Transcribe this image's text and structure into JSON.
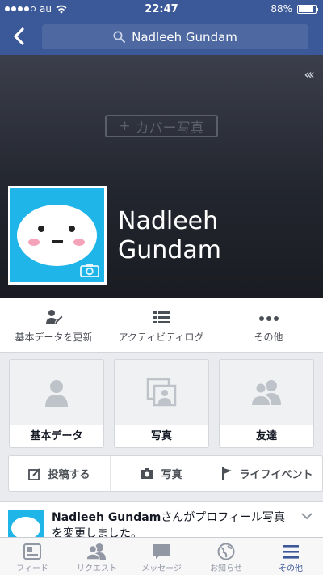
{
  "status_bar": {
    "carrier": "au",
    "time": "22:47",
    "battery": "88%"
  },
  "search": {
    "text": "Nadleeh Gundam"
  },
  "cover": {
    "add_cover_label": "カバー写真"
  },
  "profile": {
    "name_line1": "Nadleeh",
    "name_line2": "Gundam"
  },
  "actions": [
    {
      "label": "基本データを更新",
      "icon": "edit-profile-icon"
    },
    {
      "label": "アクティビティログ",
      "icon": "list-icon"
    },
    {
      "label": "その他",
      "icon": "more-icon"
    }
  ],
  "cards": [
    {
      "label": "基本データ",
      "icon": "person-icon"
    },
    {
      "label": "写真",
      "icon": "photos-icon"
    },
    {
      "label": "友達",
      "icon": "friends-icon"
    }
  ],
  "post_bar": [
    {
      "label": "投稿する",
      "icon": "compose-icon"
    },
    {
      "label": "写真",
      "icon": "camera-icon"
    },
    {
      "label": "ライフイベント",
      "icon": "flag-icon"
    }
  ],
  "story": {
    "name": "Nadleeh Gundam",
    "text": "さんがプロフィール写真を変更しました。"
  },
  "tabs": [
    {
      "label": "フィード",
      "icon": "feed-icon",
      "active": false
    },
    {
      "label": "リクエスト",
      "icon": "requests-icon",
      "active": false
    },
    {
      "label": "メッセージ",
      "icon": "messages-icon",
      "active": false
    },
    {
      "label": "お知らせ",
      "icon": "globe-icon",
      "active": false
    },
    {
      "label": "その他",
      "icon": "menu-icon",
      "active": true
    }
  ],
  "colors": {
    "brand": "#3b5998",
    "avatar_bg": "#1fb5e9"
  }
}
